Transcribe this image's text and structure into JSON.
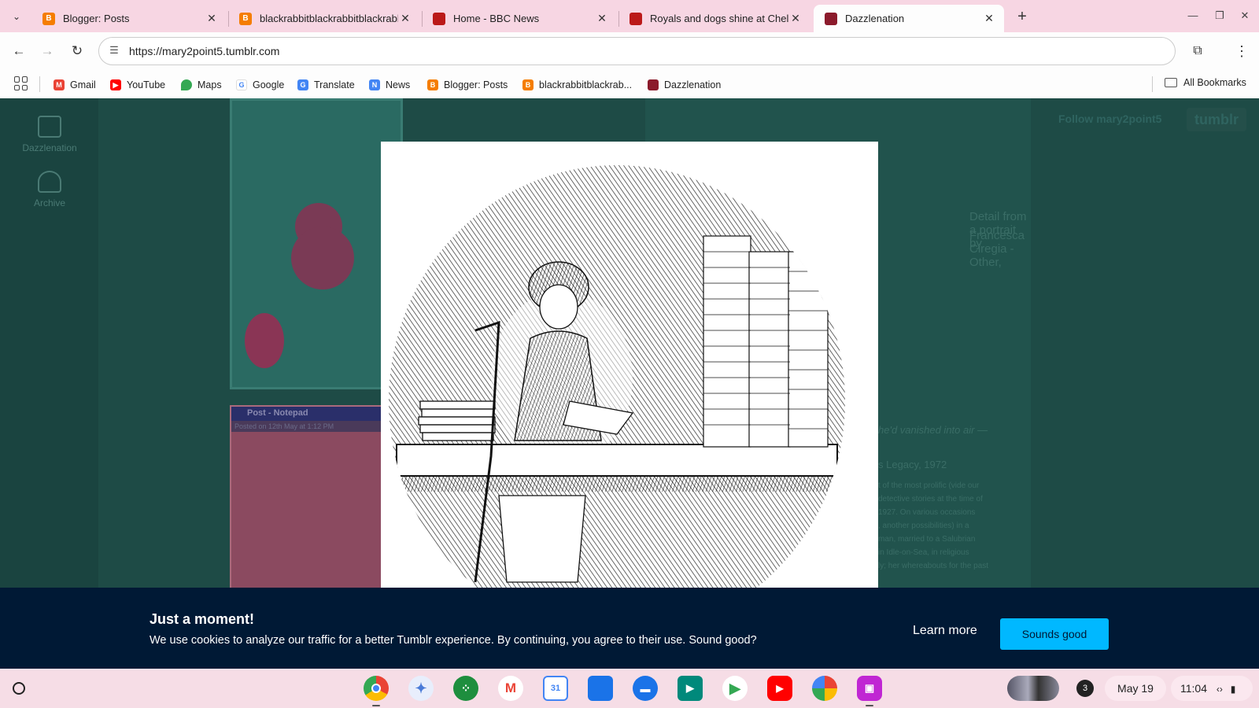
{
  "browser": {
    "tabs": [
      {
        "title": "Blogger: Posts",
        "favicon": "blogger-icon",
        "color": "#f57d00",
        "active": false
      },
      {
        "title": "blackrabbitblackrabbitblackrabbit",
        "favicon": "blogger-icon",
        "color": "#f57d00",
        "active": false
      },
      {
        "title": "Home - BBC News",
        "favicon": "bbc-news-icon",
        "color": "#bb1919",
        "active": false
      },
      {
        "title": "Royals and dogs shine at Chelsea",
        "favicon": "bbc-news-icon",
        "color": "#bb1919",
        "active": false
      },
      {
        "title": "Dazzlenation",
        "favicon": "tumblr-blog-icon",
        "color": "#8b1a2b",
        "active": true
      }
    ],
    "url": "https://mary2point5.tumblr.com",
    "bookmarks": [
      {
        "label": "Gmail",
        "icon": "gmail-icon",
        "color": "#ea4335",
        "glyph": "M"
      },
      {
        "label": "YouTube",
        "icon": "youtube-icon",
        "color": "#ff0000",
        "glyph": "▶"
      },
      {
        "label": "Maps",
        "icon": "maps-icon",
        "color": "#34a853",
        "glyph": "●"
      },
      {
        "label": "Google",
        "icon": "google-icon",
        "color": "#4285f4",
        "glyph": "G"
      },
      {
        "label": "Translate",
        "icon": "translate-icon",
        "color": "#4285f4",
        "glyph": "G"
      },
      {
        "label": "News",
        "icon": "google-news-icon",
        "color": "#4285f4",
        "glyph": "N"
      },
      {
        "label": "Blogger: Posts",
        "icon": "blogger-icon",
        "color": "#f57d00",
        "glyph": "B"
      },
      {
        "label": "blackrabbitblackrab...",
        "icon": "blogger-icon",
        "color": "#f57d00",
        "glyph": "B"
      },
      {
        "label": "Dazzlenation",
        "icon": "tumblr-blog-icon",
        "color": "#8b1a2b",
        "glyph": ""
      }
    ],
    "all_bookmarks": "All Bookmarks"
  },
  "page": {
    "sidebar": [
      {
        "label": "Dazzlenation"
      },
      {
        "label": "Archive"
      }
    ],
    "notepad_title": "Post - Notepad",
    "notepad_posted": "Posted on 12th May at 1:12 PM",
    "follow": "Follow mary2point5",
    "tumblr_logo": "tumblr",
    "caption_line1": "Detail from a portrait by",
    "caption_line2": "Francesca Ciregia - Other,",
    "quote": "he'd vanished into air —",
    "legacy": "s Legacy, 1972",
    "body_text": [
      "t of the most prolific (vide our",
      "detective stories at the time of",
      "1927. On various occasions",
      ", another possibilities) in a",
      "man, married to a Salubrian",
      "in Idle-on-Sea, in religious",
      "ly; her whereabouts for the past"
    ]
  },
  "cookie_banner": {
    "title": "Just a moment!",
    "message": "We use cookies to analyze our traffic for a better Tumblr experience. By continuing, you agree to their use. Sound good?",
    "learn_more": "Learn more",
    "accept": "Sounds good",
    "accept_color": "#00b8ff",
    "background": "#001935"
  },
  "shelf": {
    "apps": [
      {
        "name": "chrome-icon",
        "color": "#4285f4"
      },
      {
        "name": "gemini-icon",
        "color": "#4a7bd8"
      },
      {
        "name": "app-launcher-icon",
        "color": "#1e8e3e"
      },
      {
        "name": "gmail-icon",
        "color": "#ea4335"
      },
      {
        "name": "calendar-icon",
        "color": "#4285f4"
      },
      {
        "name": "files-icon",
        "color": "#1a73e8"
      },
      {
        "name": "messages-icon",
        "color": "#1a73e8"
      },
      {
        "name": "meet-icon",
        "color": "#00897b"
      },
      {
        "name": "play-store-icon",
        "color": "#34a853"
      },
      {
        "name": "youtube-icon",
        "color": "#ff0000"
      },
      {
        "name": "photos-icon",
        "color": "#fbbc04"
      },
      {
        "name": "screencast-icon",
        "color": "#c026d3"
      }
    ],
    "notification_count": "3",
    "date": "May 19",
    "time": "11:04"
  }
}
